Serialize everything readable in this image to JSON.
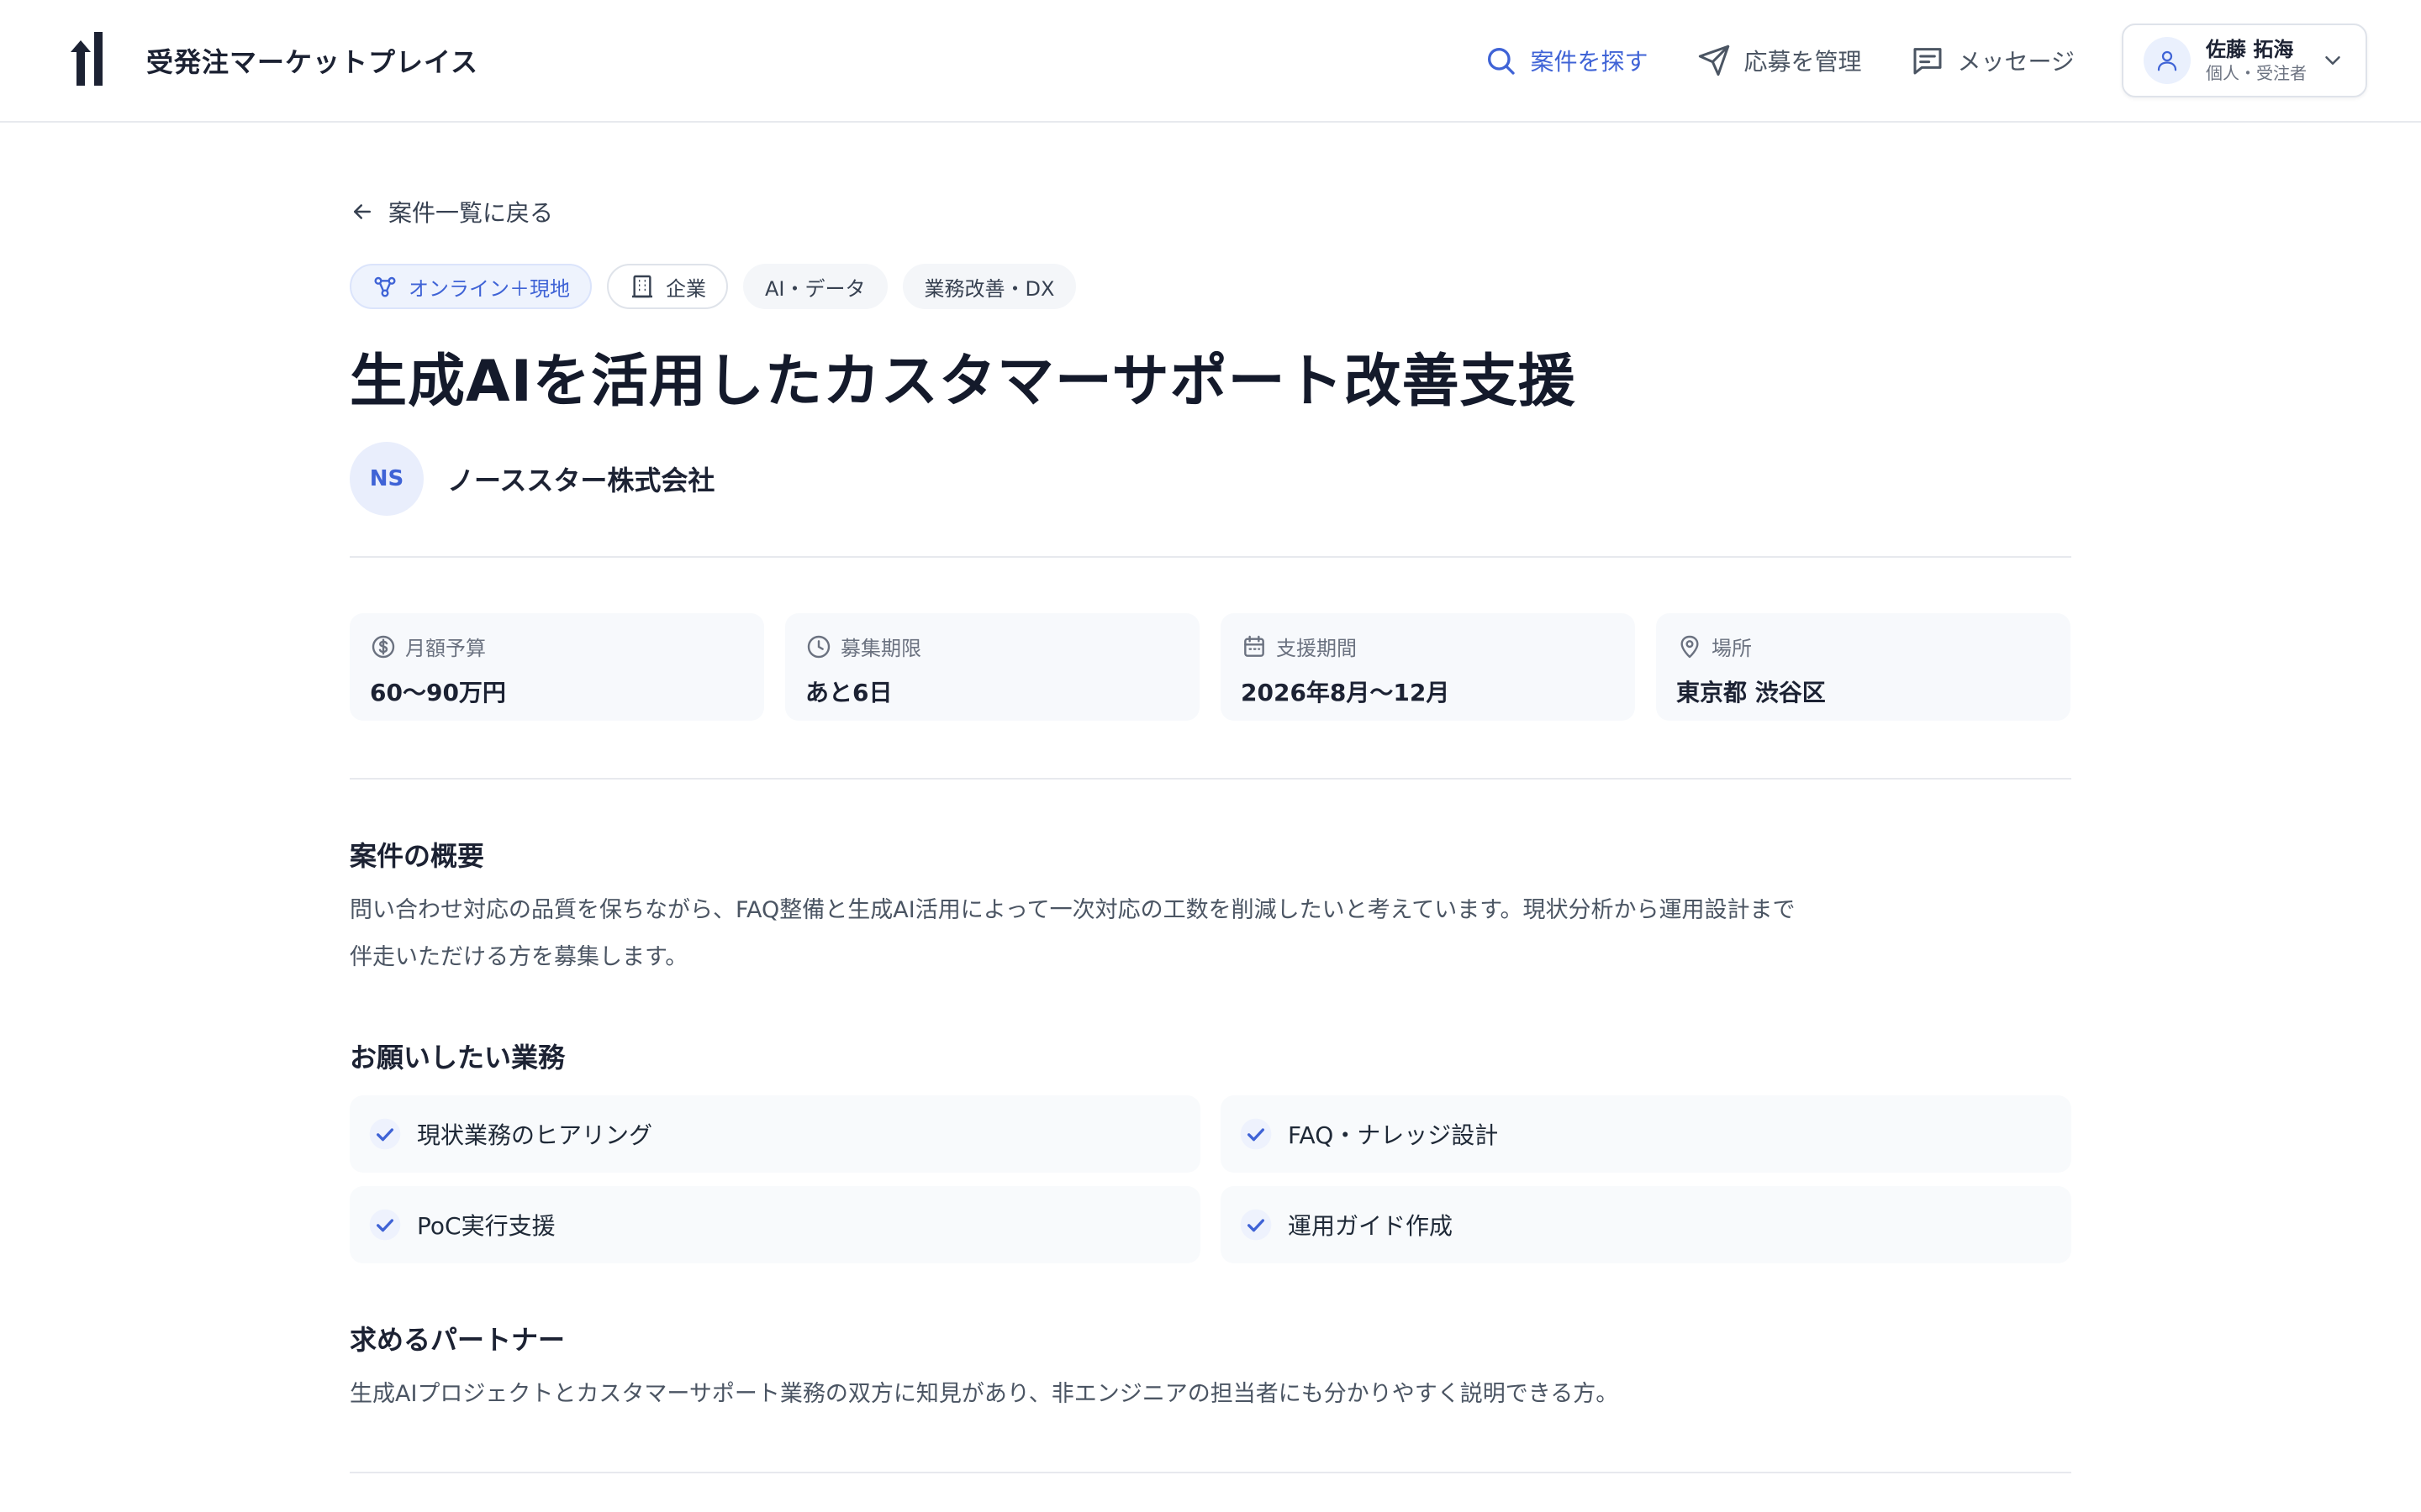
{
  "header": {
    "brand_name": "受発注マーケットプレイス",
    "nav": {
      "search_label": "案件を探す",
      "applications_label": "応募を管理",
      "messages_label": "メッセージ"
    },
    "user": {
      "name": "佐藤 拓海",
      "role": "個人・受注者"
    }
  },
  "colors": {
    "accent": "#3f63d6",
    "text_primary": "#1c2233",
    "text_secondary": "#4b5563",
    "card_bg": "#f7f9fc",
    "border": "#e7e9ee"
  },
  "project": {
    "back_label": "案件一覧に戻る",
    "tags": [
      "オンライン＋現地",
      "企業",
      "AI・データ",
      "業務改善・DX"
    ],
    "title": "生成AIを活用したカスタマーサポート改善支援",
    "company": {
      "initials": "NS",
      "name": "ノーススター株式会社"
    },
    "meta": [
      {
        "label": "月額予算",
        "value": "60〜90万円",
        "icon": "currency-icon"
      },
      {
        "label": "募集期限",
        "value": "あと6日",
        "icon": "clock-icon"
      },
      {
        "label": "支援期間",
        "value": "2026年8月〜12月",
        "icon": "calendar-icon"
      },
      {
        "label": "場所",
        "value": "東京都 渋谷区",
        "icon": "map-pin-icon"
      }
    ],
    "overview": {
      "title": "案件の概要",
      "line1": "問い合わせ対応の品質を保ちながら、FAQ整備と生成AI活用によって一次対応の工数を削減したいと考えています。現状分析から運用設計まで",
      "line2": "伴走いただける方を募集します。"
    },
    "tasks": {
      "title": "お願いしたい業務",
      "items": [
        "現状業務のヒアリング",
        "FAQ・ナレッジ設計",
        "PoC実行支援",
        "運用ガイド作成"
      ]
    },
    "partner": {
      "title": "求めるパートナー",
      "text": "生成AIプロジェクトとカスタマーサポート業務の双方に知見があり、非エンジニアの担当者にも分かりやすく説明できる方。"
    }
  }
}
